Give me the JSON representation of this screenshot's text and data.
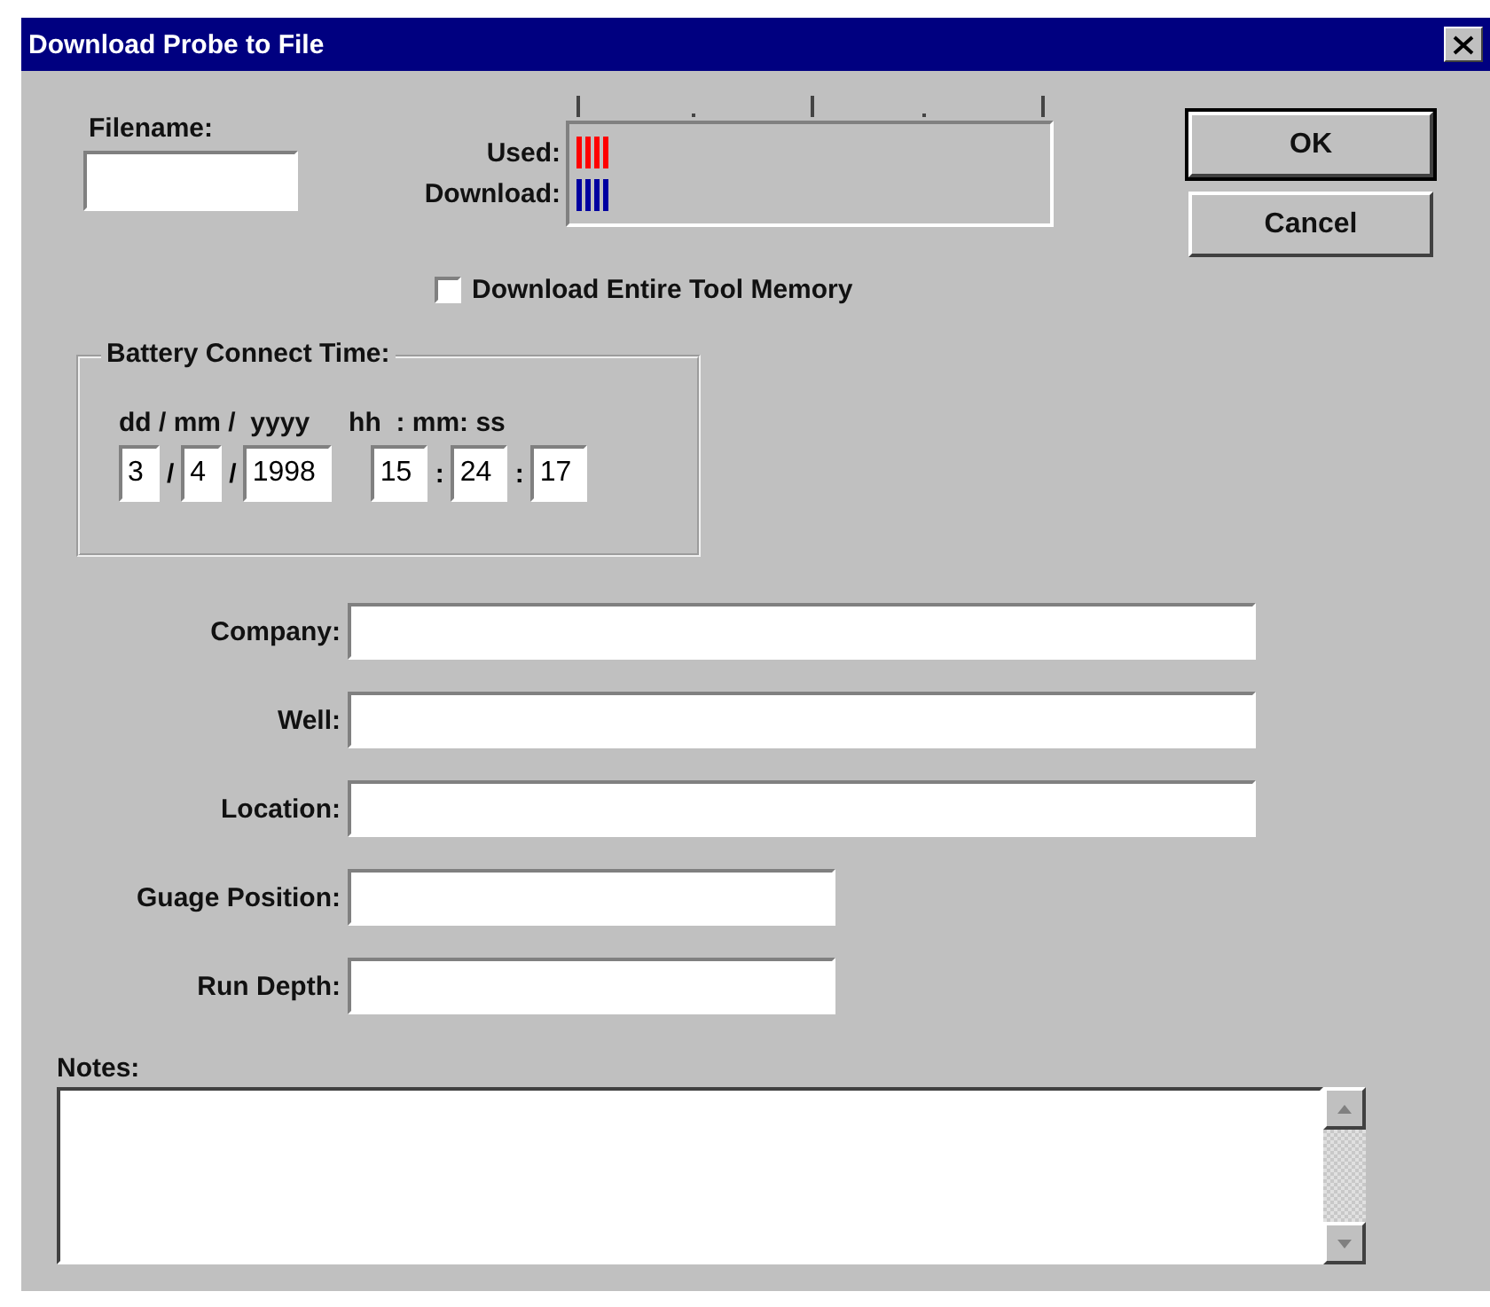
{
  "window": {
    "title": "Download Probe to File"
  },
  "filename": {
    "label": "Filename:"
  },
  "meter": {
    "rows": [
      {
        "label": "Used:",
        "level": 0.07,
        "color": "#ff0000"
      },
      {
        "label": "Download:",
        "level": 0.07,
        "color": "#0000a0"
      }
    ]
  },
  "buttons": [
    {
      "label": "OK",
      "default": true
    },
    {
      "label": "Cancel",
      "default": false
    }
  ],
  "entire_memory": {
    "label": "Download Entire Tool Memory",
    "checked": false
  },
  "battery_connect_time": {
    "legend": "Battery Connect Time:",
    "headers": [
      "dd / mm /  yyyy",
      "hh  : mm: ss"
    ],
    "parts": [
      {
        "kind": "field",
        "value": "3"
      },
      {
        "kind": "separator",
        "text": "/"
      },
      {
        "kind": "field",
        "value": "4"
      },
      {
        "kind": "separator",
        "text": "/"
      },
      {
        "kind": "field",
        "value": "1998"
      },
      {
        "kind": "gap"
      },
      {
        "kind": "field",
        "value": "15"
      },
      {
        "kind": "separator",
        "text": ":"
      },
      {
        "kind": "field",
        "value": "24"
      },
      {
        "kind": "separator",
        "text": ":"
      },
      {
        "kind": "field",
        "value": "17"
      }
    ]
  },
  "fields": [
    {
      "label": "Company:",
      "kind": "long"
    },
    {
      "label": "Well:",
      "kind": "long"
    },
    {
      "label": "Location:",
      "kind": "long"
    },
    {
      "label": "Guage Position:",
      "kind": "short"
    },
    {
      "label": "Run Depth:",
      "kind": "short"
    }
  ],
  "notes": {
    "label": "Notes:"
  }
}
